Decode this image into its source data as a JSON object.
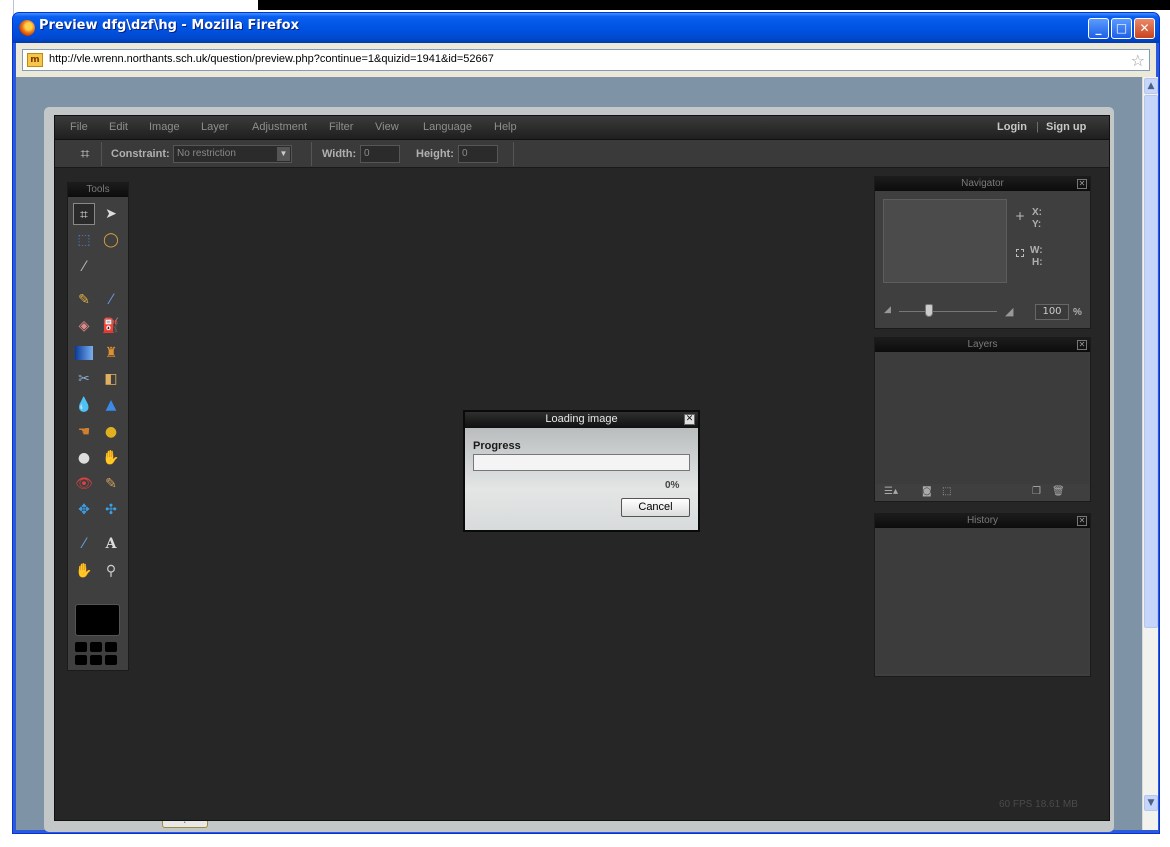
{
  "window": {
    "title": "Preview dfg\\dzf\\hg - Mozilla Firefox",
    "minimize": "_",
    "maximize": "□",
    "close": "✕"
  },
  "address_bar": {
    "url": "http://vle.wrenn.northants.sch.uk/question/preview.php?continue=1&quizid=1941&id=52667",
    "favicon": "m",
    "bookmark_star": "☆"
  },
  "editor": {
    "menu": [
      "File",
      "Edit",
      "Image",
      "Layer",
      "Adjustment",
      "Filter",
      "View",
      "Language",
      "Help"
    ],
    "login": "Login",
    "separator": "|",
    "signup": "Sign up",
    "options": {
      "constraint_label": "Constraint:",
      "constraint_value": "No restriction",
      "width_label": "Width:",
      "width_value": "0",
      "height_label": "Height:",
      "height_value": "0"
    },
    "tools_title": "Tools",
    "navigator": {
      "title": "Navigator",
      "x_label": "X:",
      "y_label": "Y:",
      "w_label": "W:",
      "h_label": "H:",
      "zoom": "100",
      "zoom_unit": "%"
    },
    "layers_title": "Layers",
    "history_title": "History",
    "status": "60 FPS 18.61 MB"
  },
  "dialog": {
    "title": "Loading image",
    "progress_label": "Progress",
    "progress_value": 0,
    "progress_text": "0%",
    "cancel": "Cancel"
  },
  "colors": {
    "app_background": "#262626",
    "titlebar": "#0054e3",
    "dialog_background": "#cfd3d3"
  }
}
